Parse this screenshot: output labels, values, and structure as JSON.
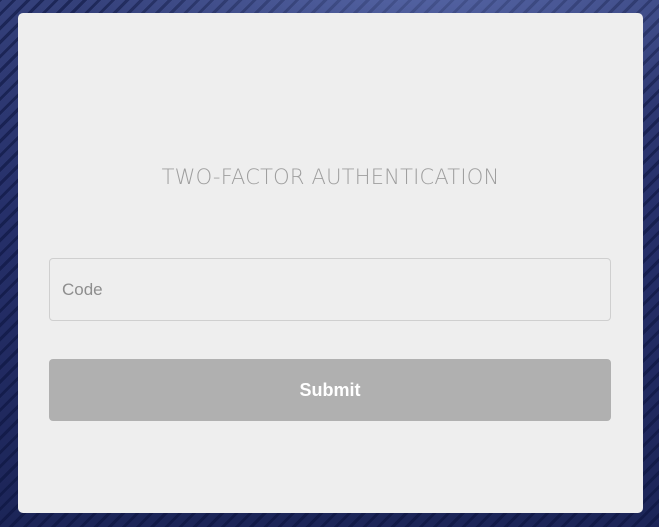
{
  "card": {
    "title": "TWO-FACTOR AUTHENTICATION"
  },
  "form": {
    "code_placeholder": "Code",
    "code_value": "",
    "submit_label": "Submit"
  },
  "colors": {
    "background": "#27336a",
    "card": "#eeeeee",
    "button": "#b0b0b0",
    "button_text": "#ffffff",
    "title_text": "#9a9a9a"
  }
}
